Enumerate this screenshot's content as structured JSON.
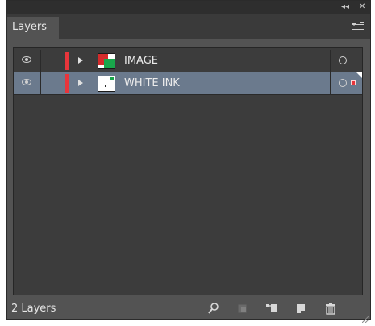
{
  "window": {
    "collapse_glyph": "◂◂",
    "close_glyph": "✕"
  },
  "panel": {
    "tab_label": "Layers",
    "menu_icon": "panel-menu-icon"
  },
  "layers": [
    {
      "name": "IMAGE",
      "visible": true,
      "selected": false,
      "color": "#e8353b",
      "thumbnail": "image-thumbnail"
    },
    {
      "name": "WHITE INK",
      "visible": true,
      "selected": true,
      "color": "#e8353b",
      "thumbnail": "white-ink-thumbnail"
    }
  ],
  "footer": {
    "count_label": "2 Layers",
    "buttons": [
      "locate-object-icon",
      "make-clipping-mask-icon",
      "create-sublayer-icon",
      "create-new-layer-icon",
      "delete-layer-icon"
    ]
  },
  "colors": {
    "panel_bg": "#535353",
    "list_bg": "#3c3c3c",
    "selected_row": "#6b7a8d",
    "layer_color": "#e8353b"
  }
}
